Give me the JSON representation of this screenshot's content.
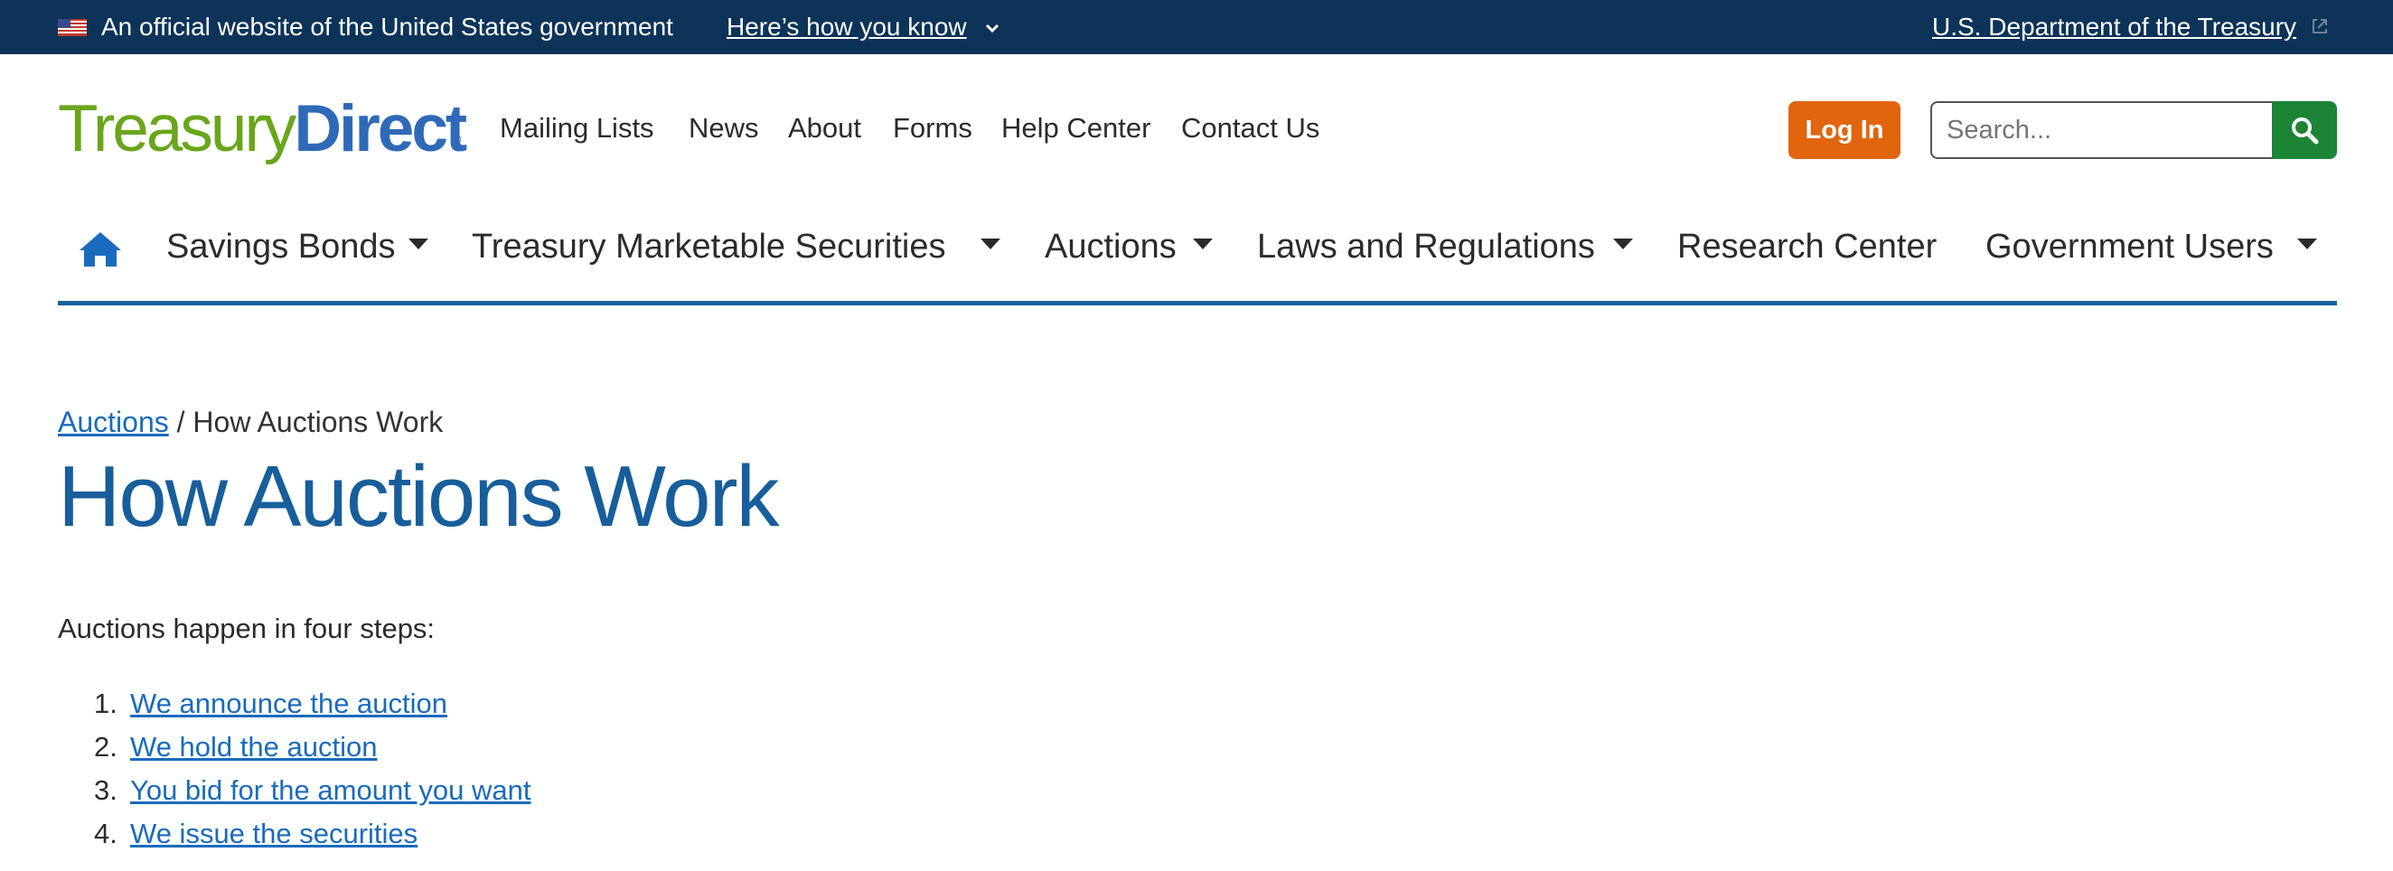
{
  "gov_banner": {
    "official_text": "An official website of the United States government",
    "how_you_know": "Here’s how you know",
    "treasury_link": "U.S. Department of the Treasury"
  },
  "logo": {
    "part1": "Treasury",
    "part2": "Direct",
    "reg": "®"
  },
  "utility_nav": [
    "Mailing Lists",
    "News",
    "About",
    "Forms",
    "Help Center",
    "Contact Us"
  ],
  "header": {
    "login_label": "Log In",
    "search_placeholder": "Search..."
  },
  "main_nav": {
    "home_icon": "home-icon",
    "items": [
      {
        "label": "Savings Bonds",
        "dropdown": true
      },
      {
        "label": "Treasury Marketable Securities",
        "dropdown": true
      },
      {
        "label": "Auctions",
        "dropdown": true
      },
      {
        "label": "Laws and Regulations",
        "dropdown": true
      },
      {
        "label": "Research Center",
        "dropdown": false
      },
      {
        "label": "Government Users",
        "dropdown": true
      }
    ]
  },
  "breadcrumb": {
    "parent": "Auctions",
    "separator": " / ",
    "current": "How Auctions Work"
  },
  "page_title": "How Auctions Work",
  "intro": "Auctions happen in four steps:",
  "steps": [
    {
      "num": "1.",
      "label": "We announce the auction"
    },
    {
      "num": "2.",
      "label": "We hold the auction"
    },
    {
      "num": "3.",
      "label": "You bid for the amount you want"
    },
    {
      "num": "4.",
      "label": "We issue the securities"
    }
  ],
  "colors": {
    "banner_bg": "#0d3359",
    "logo_green": "#6aa51b",
    "logo_blue": "#2f6ab8",
    "login_orange": "#e0650e",
    "search_green": "#1b8535",
    "nav_rule": "#11639e",
    "title_blue": "#175e9b",
    "link_blue": "#1a6bbd"
  }
}
